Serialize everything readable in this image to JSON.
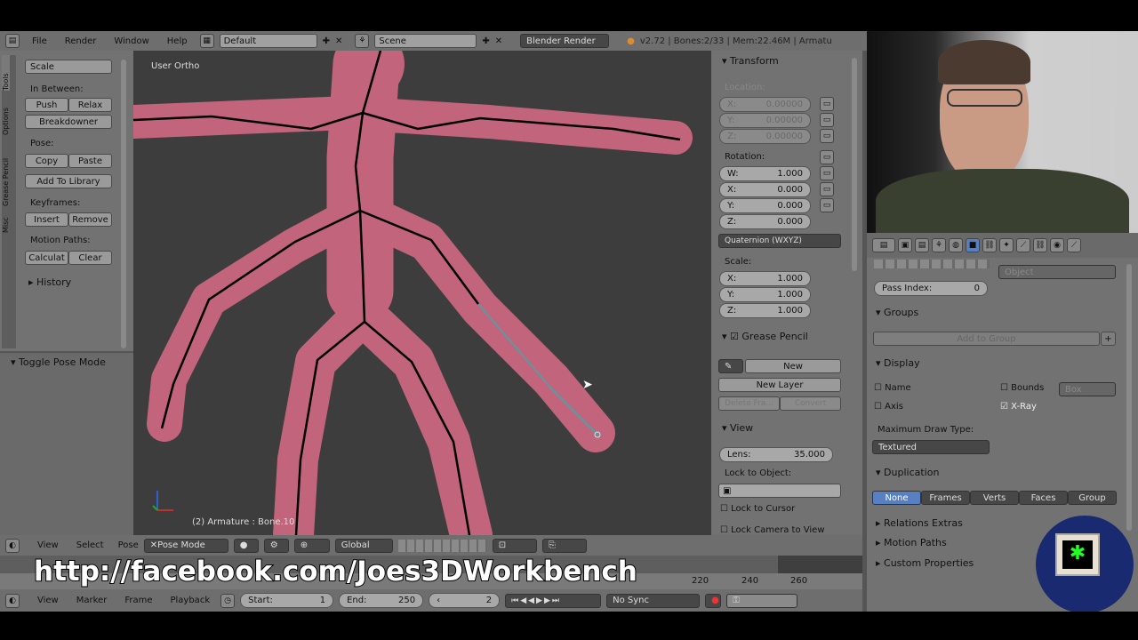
{
  "top_bar": {
    "menus": [
      "File",
      "Render",
      "Window",
      "Help"
    ],
    "layout": "Default",
    "scene": "Scene",
    "engine": "Blender Render",
    "stats": "v2.72 | Bones:2/33 | Mem:22.46M | Armatu"
  },
  "tool_panel": {
    "scale": "Scale",
    "in_between_label": "In Between:",
    "push": "Push",
    "relax": "Relax",
    "breakdowner": "Breakdowner",
    "pose_label": "Pose:",
    "copy": "Copy",
    "paste": "Paste",
    "add_to_library": "Add To Library",
    "keyframes_label": "Keyframes:",
    "insert": "Insert",
    "remove": "Remove",
    "motion_paths_label": "Motion Paths:",
    "calculate": "Calculat",
    "clear": "Clear",
    "history": "History",
    "tabs": [
      "Tools",
      "Options",
      "Grease Pencil",
      "Misc"
    ],
    "toggle_pose_mode": "Toggle Pose Mode"
  },
  "viewport": {
    "view_label": "User Ortho",
    "status": "(2) Armature : Bone.10"
  },
  "n_panel": {
    "transform": "Transform",
    "location": "Location:",
    "loc": [
      {
        "axis": "X:",
        "value": "0.00000"
      },
      {
        "axis": "Y:",
        "value": "0.00000"
      },
      {
        "axis": "Z:",
        "value": "0.00000"
      }
    ],
    "rotation": "Rotation:",
    "rot": [
      {
        "axis": "W:",
        "value": "1.000"
      },
      {
        "axis": "X:",
        "value": "0.000"
      },
      {
        "axis": "Y:",
        "value": "0.000"
      },
      {
        "axis": "Z:",
        "value": "0.000"
      }
    ],
    "rotation_mode": "Quaternion (WXYZ)",
    "scale": "Scale:",
    "scl": [
      {
        "axis": "X:",
        "value": "1.000"
      },
      {
        "axis": "Y:",
        "value": "1.000"
      },
      {
        "axis": "Z:",
        "value": "1.000"
      }
    ],
    "grease_pencil": "Grease Pencil",
    "new": "New",
    "new_layer": "New Layer",
    "delete_frame": "Delete Fra...",
    "convert": "Convert",
    "view": "View",
    "lens": "Lens:",
    "lens_value": "35.000",
    "lock_to_object": "Lock to Object:",
    "lock_to_cursor": "Lock to Cursor",
    "lock_camera": "Lock Camera to View"
  },
  "properties": {
    "parent_type": "Object",
    "pass_index_label": "Pass Index:",
    "pass_index": "0",
    "groups": "Groups",
    "add_to_group": "Add to Group",
    "display": "Display",
    "name": "Name",
    "axis": "Axis",
    "bounds": "Bounds",
    "bounds_type": "Box",
    "xray": "X-Ray",
    "max_draw_type_label": "Maximum Draw Type:",
    "max_draw_type": "Textured",
    "duplication": "Duplication",
    "dup_options": [
      "None",
      "Frames",
      "Verts",
      "Faces",
      "Group"
    ],
    "relations_extras": "Relations Extras",
    "motion_paths": "Motion Paths",
    "custom_properties": "Custom Properties"
  },
  "view3d_header": {
    "menus": [
      "View",
      "Select",
      "Pose"
    ],
    "mode": "Pose Mode",
    "orientation": "Global"
  },
  "timeline": {
    "overlay": "http://facebook.com/Joes3DWorkbench",
    "ticks": [
      "220",
      "240",
      "260"
    ],
    "menus": [
      "View",
      "Marker",
      "Frame",
      "Playback"
    ],
    "start_label": "Start:",
    "start": "1",
    "end_label": "End:",
    "end": "250",
    "current": "2",
    "sync": "No Sync"
  },
  "colors": {
    "mesh": "#c0607a",
    "accent": "#5680c2",
    "panel": "#727272",
    "viewport": "#3d3d3d"
  }
}
